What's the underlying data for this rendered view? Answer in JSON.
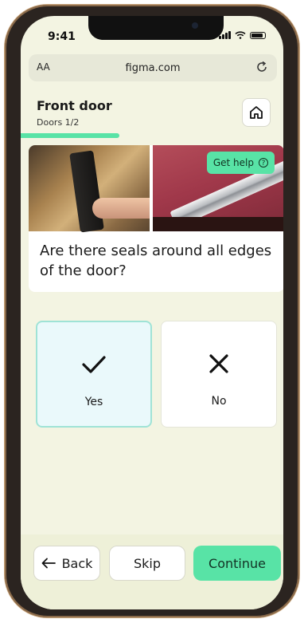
{
  "status_bar": {
    "time": "9:41"
  },
  "browser": {
    "text_size_label": "AA",
    "url": "figma.com"
  },
  "header": {
    "title": "Front door",
    "subtitle": "Doors 1/2",
    "progress_fraction": 0.375
  },
  "question_card": {
    "help_label": "Get help",
    "help_icon": "?",
    "question": "Are there seals around all edges of the door?"
  },
  "answers": {
    "yes_label": "Yes",
    "no_label": "No",
    "selected": "yes"
  },
  "footer": {
    "back_label": "Back",
    "skip_label": "Skip",
    "continue_label": "Continue"
  },
  "colors": {
    "accent": "#58e3a6",
    "background": "#f3f4e2",
    "selected_bg": "#eaf9fb",
    "selected_border": "#9fe3d6"
  }
}
